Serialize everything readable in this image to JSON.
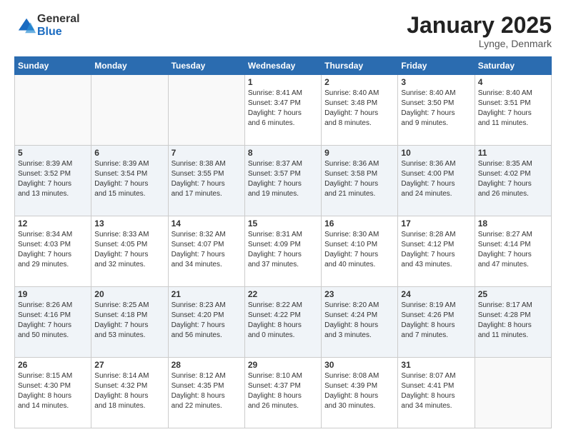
{
  "header": {
    "logo_general": "General",
    "logo_blue": "Blue",
    "month_title": "January 2025",
    "location": "Lynge, Denmark"
  },
  "weekdays": [
    "Sunday",
    "Monday",
    "Tuesday",
    "Wednesday",
    "Thursday",
    "Friday",
    "Saturday"
  ],
  "weeks": [
    [
      {
        "day": "",
        "info": ""
      },
      {
        "day": "",
        "info": ""
      },
      {
        "day": "",
        "info": ""
      },
      {
        "day": "1",
        "info": "Sunrise: 8:41 AM\nSunset: 3:47 PM\nDaylight: 7 hours\nand 6 minutes."
      },
      {
        "day": "2",
        "info": "Sunrise: 8:40 AM\nSunset: 3:48 PM\nDaylight: 7 hours\nand 8 minutes."
      },
      {
        "day": "3",
        "info": "Sunrise: 8:40 AM\nSunset: 3:50 PM\nDaylight: 7 hours\nand 9 minutes."
      },
      {
        "day": "4",
        "info": "Sunrise: 8:40 AM\nSunset: 3:51 PM\nDaylight: 7 hours\nand 11 minutes."
      }
    ],
    [
      {
        "day": "5",
        "info": "Sunrise: 8:39 AM\nSunset: 3:52 PM\nDaylight: 7 hours\nand 13 minutes."
      },
      {
        "day": "6",
        "info": "Sunrise: 8:39 AM\nSunset: 3:54 PM\nDaylight: 7 hours\nand 15 minutes."
      },
      {
        "day": "7",
        "info": "Sunrise: 8:38 AM\nSunset: 3:55 PM\nDaylight: 7 hours\nand 17 minutes."
      },
      {
        "day": "8",
        "info": "Sunrise: 8:37 AM\nSunset: 3:57 PM\nDaylight: 7 hours\nand 19 minutes."
      },
      {
        "day": "9",
        "info": "Sunrise: 8:36 AM\nSunset: 3:58 PM\nDaylight: 7 hours\nand 21 minutes."
      },
      {
        "day": "10",
        "info": "Sunrise: 8:36 AM\nSunset: 4:00 PM\nDaylight: 7 hours\nand 24 minutes."
      },
      {
        "day": "11",
        "info": "Sunrise: 8:35 AM\nSunset: 4:02 PM\nDaylight: 7 hours\nand 26 minutes."
      }
    ],
    [
      {
        "day": "12",
        "info": "Sunrise: 8:34 AM\nSunset: 4:03 PM\nDaylight: 7 hours\nand 29 minutes."
      },
      {
        "day": "13",
        "info": "Sunrise: 8:33 AM\nSunset: 4:05 PM\nDaylight: 7 hours\nand 32 minutes."
      },
      {
        "day": "14",
        "info": "Sunrise: 8:32 AM\nSunset: 4:07 PM\nDaylight: 7 hours\nand 34 minutes."
      },
      {
        "day": "15",
        "info": "Sunrise: 8:31 AM\nSunset: 4:09 PM\nDaylight: 7 hours\nand 37 minutes."
      },
      {
        "day": "16",
        "info": "Sunrise: 8:30 AM\nSunset: 4:10 PM\nDaylight: 7 hours\nand 40 minutes."
      },
      {
        "day": "17",
        "info": "Sunrise: 8:28 AM\nSunset: 4:12 PM\nDaylight: 7 hours\nand 43 minutes."
      },
      {
        "day": "18",
        "info": "Sunrise: 8:27 AM\nSunset: 4:14 PM\nDaylight: 7 hours\nand 47 minutes."
      }
    ],
    [
      {
        "day": "19",
        "info": "Sunrise: 8:26 AM\nSunset: 4:16 PM\nDaylight: 7 hours\nand 50 minutes."
      },
      {
        "day": "20",
        "info": "Sunrise: 8:25 AM\nSunset: 4:18 PM\nDaylight: 7 hours\nand 53 minutes."
      },
      {
        "day": "21",
        "info": "Sunrise: 8:23 AM\nSunset: 4:20 PM\nDaylight: 7 hours\nand 56 minutes."
      },
      {
        "day": "22",
        "info": "Sunrise: 8:22 AM\nSunset: 4:22 PM\nDaylight: 8 hours\nand 0 minutes."
      },
      {
        "day": "23",
        "info": "Sunrise: 8:20 AM\nSunset: 4:24 PM\nDaylight: 8 hours\nand 3 minutes."
      },
      {
        "day": "24",
        "info": "Sunrise: 8:19 AM\nSunset: 4:26 PM\nDaylight: 8 hours\nand 7 minutes."
      },
      {
        "day": "25",
        "info": "Sunrise: 8:17 AM\nSunset: 4:28 PM\nDaylight: 8 hours\nand 11 minutes."
      }
    ],
    [
      {
        "day": "26",
        "info": "Sunrise: 8:15 AM\nSunset: 4:30 PM\nDaylight: 8 hours\nand 14 minutes."
      },
      {
        "day": "27",
        "info": "Sunrise: 8:14 AM\nSunset: 4:32 PM\nDaylight: 8 hours\nand 18 minutes."
      },
      {
        "day": "28",
        "info": "Sunrise: 8:12 AM\nSunset: 4:35 PM\nDaylight: 8 hours\nand 22 minutes."
      },
      {
        "day": "29",
        "info": "Sunrise: 8:10 AM\nSunset: 4:37 PM\nDaylight: 8 hours\nand 26 minutes."
      },
      {
        "day": "30",
        "info": "Sunrise: 8:08 AM\nSunset: 4:39 PM\nDaylight: 8 hours\nand 30 minutes."
      },
      {
        "day": "31",
        "info": "Sunrise: 8:07 AM\nSunset: 4:41 PM\nDaylight: 8 hours\nand 34 minutes."
      },
      {
        "day": "",
        "info": ""
      }
    ]
  ]
}
